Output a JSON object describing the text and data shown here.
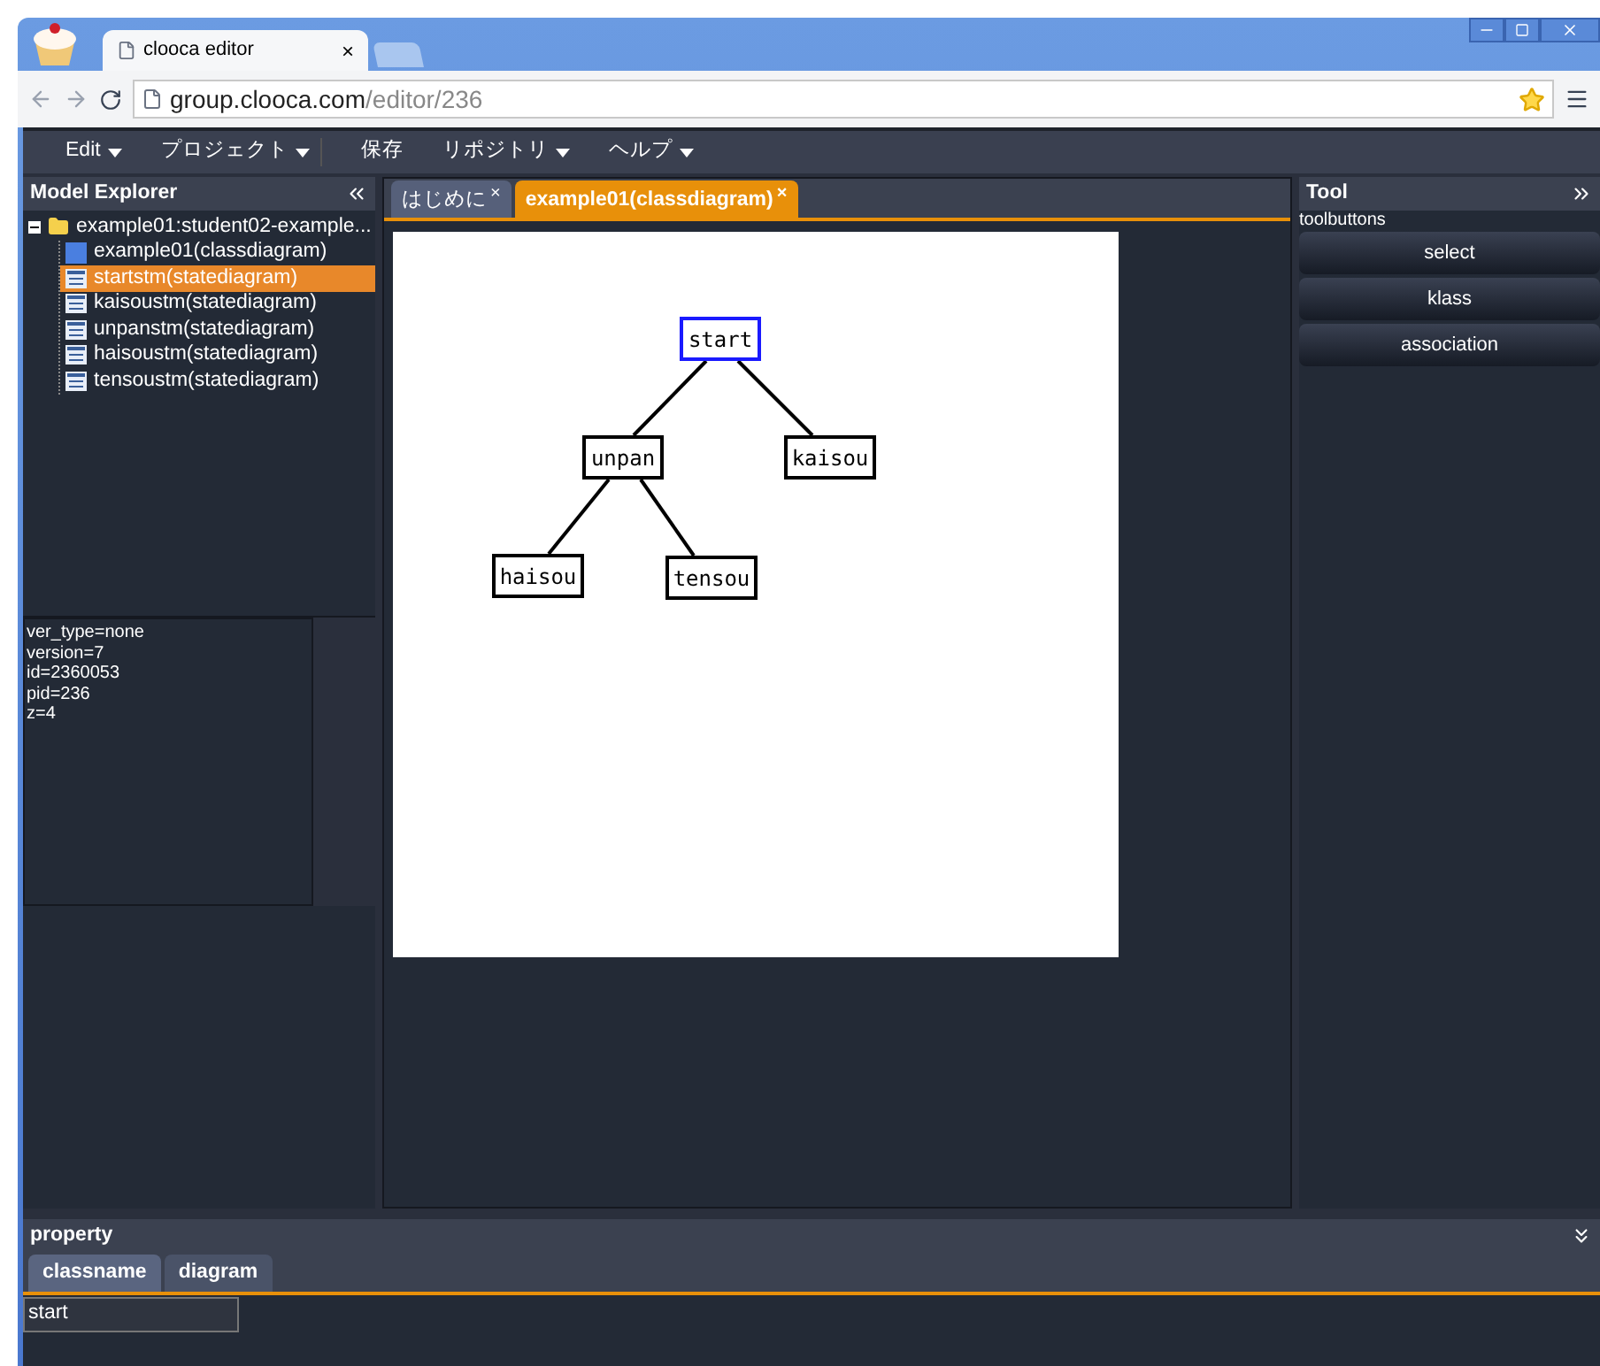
{
  "browser": {
    "tab_title": "clooca editor",
    "tab_close": "×",
    "url_host": "group.clooca.com",
    "url_path": "/editor/236"
  },
  "menu": [
    {
      "label": "Edit",
      "kind": "dropdown"
    },
    {
      "label": "プロジェクト",
      "kind": "dropdown"
    },
    {
      "label": "保存",
      "kind": "action"
    },
    {
      "label": "リポジトリ",
      "kind": "dropdown"
    },
    {
      "label": "ヘルプ",
      "kind": "dropdown"
    }
  ],
  "explorer": {
    "title": "Model Explorer",
    "tree": [
      {
        "label": "example01:student02-example...",
        "kind": "folder",
        "expanded": true,
        "selected": false,
        "children": [
          {
            "label": "example01(classdiagram)",
            "kind": "class",
            "selected": false
          },
          {
            "label": "startstm(statediagram)",
            "kind": "state",
            "selected": true
          },
          {
            "label": "kaisoustm(statediagram)",
            "kind": "state",
            "selected": false
          },
          {
            "label": "unpanstm(statediagram)",
            "kind": "state",
            "selected": false
          },
          {
            "label": "haisoustm(statediagram)",
            "kind": "state",
            "selected": false
          },
          {
            "label": "tensoustm(statediagram)",
            "kind": "state",
            "selected": false
          }
        ]
      }
    ]
  },
  "info": [
    "ver_type=none",
    "version=7",
    "id=2360053",
    "pid=236",
    "z=4"
  ],
  "editor_tabs": [
    {
      "label": "はじめに",
      "close": "×",
      "selected": false
    },
    {
      "label": "example01(classdiagram)",
      "close": "×",
      "selected": true
    }
  ],
  "diagram": {
    "nodes": [
      {
        "label": "start",
        "selected": true,
        "children": [
          {
            "label": "unpan",
            "selected": false,
            "children": [
              {
                "label": "haisou",
                "selected": false
              },
              {
                "label": "tensou",
                "selected": false
              }
            ]
          },
          {
            "label": "kaisou",
            "selected": false
          }
        ]
      }
    ]
  },
  "tool": {
    "title": "Tool",
    "section": "toolbuttons",
    "buttons": [
      "select",
      "klass",
      "association"
    ]
  },
  "property": {
    "title": "property",
    "tabs": [
      {
        "label": "classname",
        "selected": true
      },
      {
        "label": "diagram",
        "selected": false
      }
    ],
    "value": "start"
  }
}
